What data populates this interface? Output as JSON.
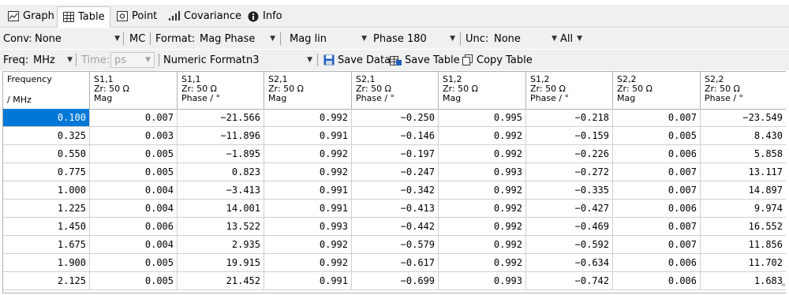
{
  "tabs": [
    {
      "label": "Graph",
      "icon": "graph-icon"
    },
    {
      "label": "Table",
      "icon": "table-icon"
    },
    {
      "label": "Point",
      "icon": "point-icon"
    },
    {
      "label": "Covariance",
      "icon": "covariance-icon"
    },
    {
      "label": "Info",
      "icon": "info-icon"
    }
  ],
  "toolbar1": {
    "conv_label": "Conv:",
    "conv_value": "None",
    "mc_label": "MC",
    "format_label": "Format:",
    "format_value": "Mag Phase",
    "mag_value": "Mag lin",
    "phase_value": "Phase 180",
    "unc_label": "Unc:",
    "unc_value": "None",
    "all_label": "All"
  },
  "toolbar2": {
    "freq_label": "Freq:",
    "freq_value": "MHz",
    "time_label": "Time:",
    "time_value": "ps",
    "numfmt_label": "Numeric Format:",
    "numfmt_value": "n3",
    "save_data_label": "Save Data",
    "save_table_label": "Save Table",
    "copy_table_label": "Copy Table"
  },
  "table": {
    "headers": [
      [
        "Frequency",
        "",
        "/ MHz"
      ],
      [
        "S1,1",
        "Zr: 50 Ω",
        "Mag"
      ],
      [
        "S1,1",
        "Zr: 50 Ω",
        "Phase / °"
      ],
      [
        "S2,1",
        "Zr: 50 Ω",
        "Mag"
      ],
      [
        "S2,1",
        "Zr: 50 Ω",
        "Phase / °"
      ],
      [
        "S1,2",
        "Zr: 50 Ω",
        "Mag"
      ],
      [
        "S1,2",
        "Zr: 50 Ω",
        "Phase / °"
      ],
      [
        "S2,2",
        "Zr: 50 Ω",
        "Mag"
      ],
      [
        "S2,2",
        "Zr: 50 Ω",
        "Phase / °"
      ]
    ],
    "rows": [
      [
        "0.100",
        "0.007",
        "−21.566",
        "0.992",
        "−0.250",
        "0.995",
        "−0.218",
        "0.007",
        "−23.549"
      ],
      [
        "0.325",
        "0.003",
        "−11.896",
        "0.991",
        "−0.146",
        "0.992",
        "−0.159",
        "0.005",
        "8.430"
      ],
      [
        "0.550",
        "0.005",
        "−1.895",
        "0.992",
        "−0.197",
        "0.992",
        "−0.226",
        "0.006",
        "5.858"
      ],
      [
        "0.775",
        "0.005",
        "0.823",
        "0.992",
        "−0.247",
        "0.993",
        "−0.272",
        "0.007",
        "13.117"
      ],
      [
        "1.000",
        "0.004",
        "−3.413",
        "0.991",
        "−0.342",
        "0.992",
        "−0.335",
        "0.007",
        "14.897"
      ],
      [
        "1.225",
        "0.004",
        "14.001",
        "0.991",
        "−0.413",
        "0.992",
        "−0.427",
        "0.006",
        "9.974"
      ],
      [
        "1.450",
        "0.006",
        "13.522",
        "0.993",
        "−0.442",
        "0.992",
        "−0.469",
        "0.007",
        "16.552"
      ],
      [
        "1.675",
        "0.004",
        "2.935",
        "0.992",
        "−0.579",
        "0.992",
        "−0.592",
        "0.007",
        "11.856"
      ],
      [
        "1.900",
        "0.005",
        "19.915",
        "0.992",
        "−0.617",
        "0.992",
        "−0.634",
        "0.006",
        "11.702"
      ],
      [
        "2.125",
        "0.005",
        "21.452",
        "0.991",
        "−0.699",
        "0.993",
        "−0.742",
        "0.006",
        "1.683"
      ]
    ]
  },
  "colors": {
    "selection": "#0078d7",
    "save_icon": "#1f5fbf"
  }
}
